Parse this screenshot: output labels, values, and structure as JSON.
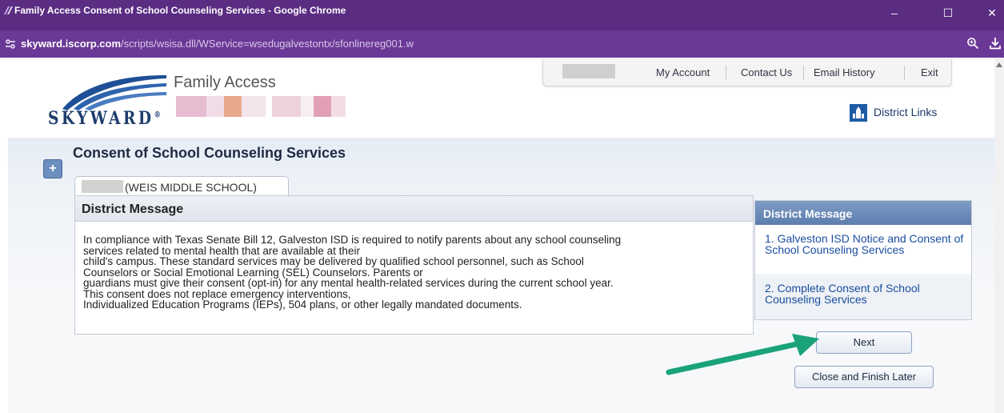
{
  "window": {
    "title": "Family Access Consent of School Counseling Services - Google Chrome",
    "controls": [
      "–",
      "☐",
      "✕"
    ]
  },
  "addressbar": {
    "host": "skyward.iscorp.com",
    "path": "/scripts/wsisa.dll/WService=wsedugalvestontx/sfonlinereg001.w"
  },
  "header": {
    "logo_text": "SKYWARD",
    "logo_mark": "®",
    "product_title": "Family Access",
    "nav": [
      "My Account",
      "Contact Us",
      "Email History",
      "Exit"
    ],
    "district_links": "District Links"
  },
  "page": {
    "title": "Consent of School Counseling Services",
    "student_tab_suffix": "(WEIS MIDDLE SCHOOL)"
  },
  "message_panel": {
    "title": "District Message",
    "lines": [
      "In compliance with Texas Senate Bill 12, Galveston ISD is required to notify parents about any school counseling",
      "services related to mental health that are available at their",
      "child's campus. These standard services may be delivered by qualified school personnel, such as School",
      "Counselors or Social Emotional Learning (SEL) Counselors. Parents or",
      "guardians must give their consent (opt-in) for any mental health-related services during the current school year.",
      "This consent does not replace emergency interventions,",
      "Individualized Education Programs (IEPs), 504 plans, or other legally mandated documents."
    ]
  },
  "steps": {
    "title": "District Message",
    "items": [
      "1. Galveston ISD Notice and Consent of School Counseling Services",
      "2. Complete Consent of School Counseling Services"
    ]
  },
  "buttons": {
    "next": "Next",
    "close_finish": "Close and Finish Later"
  },
  "colors": {
    "titlebar": "#5a2c82",
    "addressbar": "#6a3896",
    "link_blue": "#1a4ea0",
    "steps_header": "#6b8cba",
    "annotation_arrow": "#1aa37a"
  }
}
